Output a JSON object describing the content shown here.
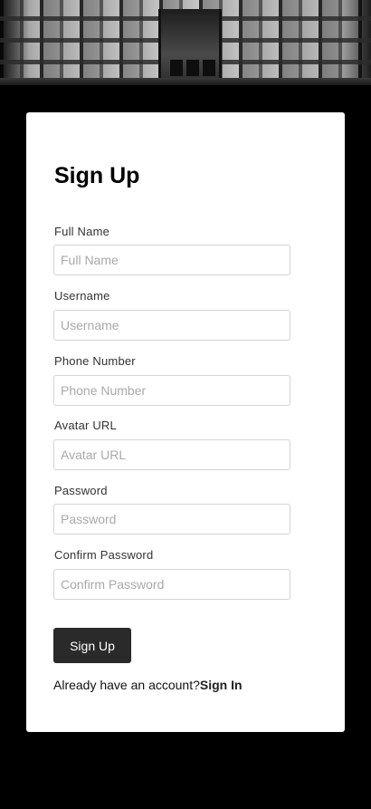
{
  "form": {
    "title": "Sign Up",
    "fields": [
      {
        "label": "Full Name",
        "placeholder": "Full Name",
        "value": ""
      },
      {
        "label": "Username",
        "placeholder": "Username",
        "value": ""
      },
      {
        "label": "Phone Number",
        "placeholder": "Phone Number",
        "value": ""
      },
      {
        "label": "Avatar URL",
        "placeholder": "Avatar URL",
        "value": ""
      },
      {
        "label": "Password",
        "placeholder": "Password",
        "value": ""
      },
      {
        "label": "Confirm Password",
        "placeholder": "Confirm Password",
        "value": ""
      }
    ],
    "submit_label": "Sign Up",
    "account_prompt": "Already have an account?",
    "signin_label": "Sign In"
  },
  "colors": {
    "page_background": "#000000",
    "card_background": "#ffffff",
    "button_background": "#2a2a2a",
    "input_border": "#d4d4d4"
  }
}
